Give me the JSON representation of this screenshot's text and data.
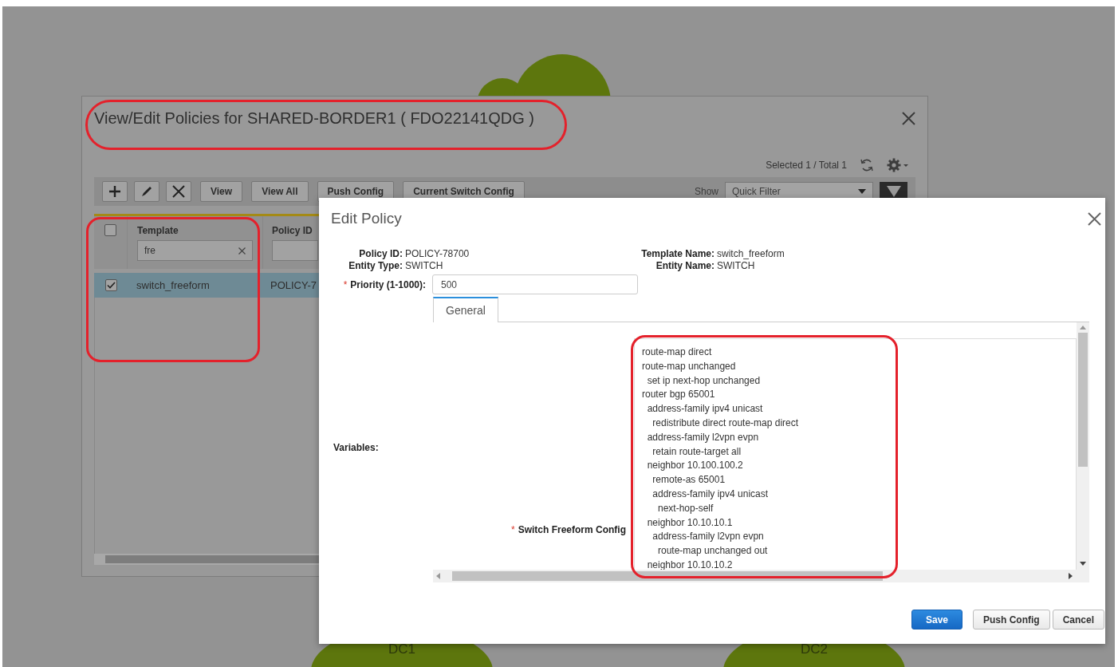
{
  "background": {
    "site_labels": [
      "DC1",
      "DC2"
    ]
  },
  "policies_dialog": {
    "title": "View/Edit Policies for SHARED-BORDER1 ( FDO22141QDG )",
    "selection_summary": "Selected 1 / Total 1",
    "toolbar": {
      "icon_buttons": [
        {
          "kind": "add"
        },
        {
          "kind": "edit"
        },
        {
          "kind": "delete"
        }
      ],
      "buttons": [
        "View",
        "View All",
        "Push Config",
        "Current Switch Config"
      ],
      "show_label": "Show",
      "filter_select": "Quick Filter"
    },
    "table": {
      "select_all_checked": false,
      "columns": [
        {
          "title": "Template",
          "filter": "fre"
        },
        {
          "title": "Policy ID"
        }
      ],
      "rows": [
        {
          "selected": true,
          "checked": true,
          "cells": [
            "switch_freeform",
            "POLICY-7"
          ]
        }
      ]
    }
  },
  "edit_policy": {
    "title": "Edit Policy",
    "info": [
      {
        "label": "Policy ID:",
        "value": "POLICY-78700"
      },
      {
        "label": "Template Name:",
        "value": "switch_freeform"
      },
      {
        "label": "Entity Type:",
        "value": "SWITCH"
      },
      {
        "label": "Entity Name:",
        "value": "SWITCH"
      }
    ],
    "priority": {
      "required_mark": "*",
      "label": "Priority (1-1000):",
      "value": "500"
    },
    "tabs": [
      {
        "label": "General",
        "selected": true
      }
    ],
    "variables_label": "Variables:",
    "freeform": {
      "required_mark": "*",
      "label": "Switch Freeform Config",
      "lines": [
        "route-map direct",
        "route-map unchanged",
        "  set ip next-hop unchanged",
        "router bgp 65001",
        "  address-family ipv4 unicast",
        "    redistribute direct route-map direct",
        "  address-family l2vpn evpn",
        "    retain route-target all",
        "  neighbor 10.100.100.2",
        "    remote-as 65001",
        "    address-family ipv4 unicast",
        "      next-hop-self",
        "  neighbor 10.10.10.1",
        "    address-family l2vpn evpn",
        "      route-map unchanged out",
        "  neighbor 10.10.10.2"
      ]
    },
    "buttons": [
      {
        "label": "Save",
        "kind": "primary"
      },
      {
        "label": "Push Config",
        "kind": "default"
      },
      {
        "label": "Cancel",
        "kind": "default"
      }
    ]
  }
}
